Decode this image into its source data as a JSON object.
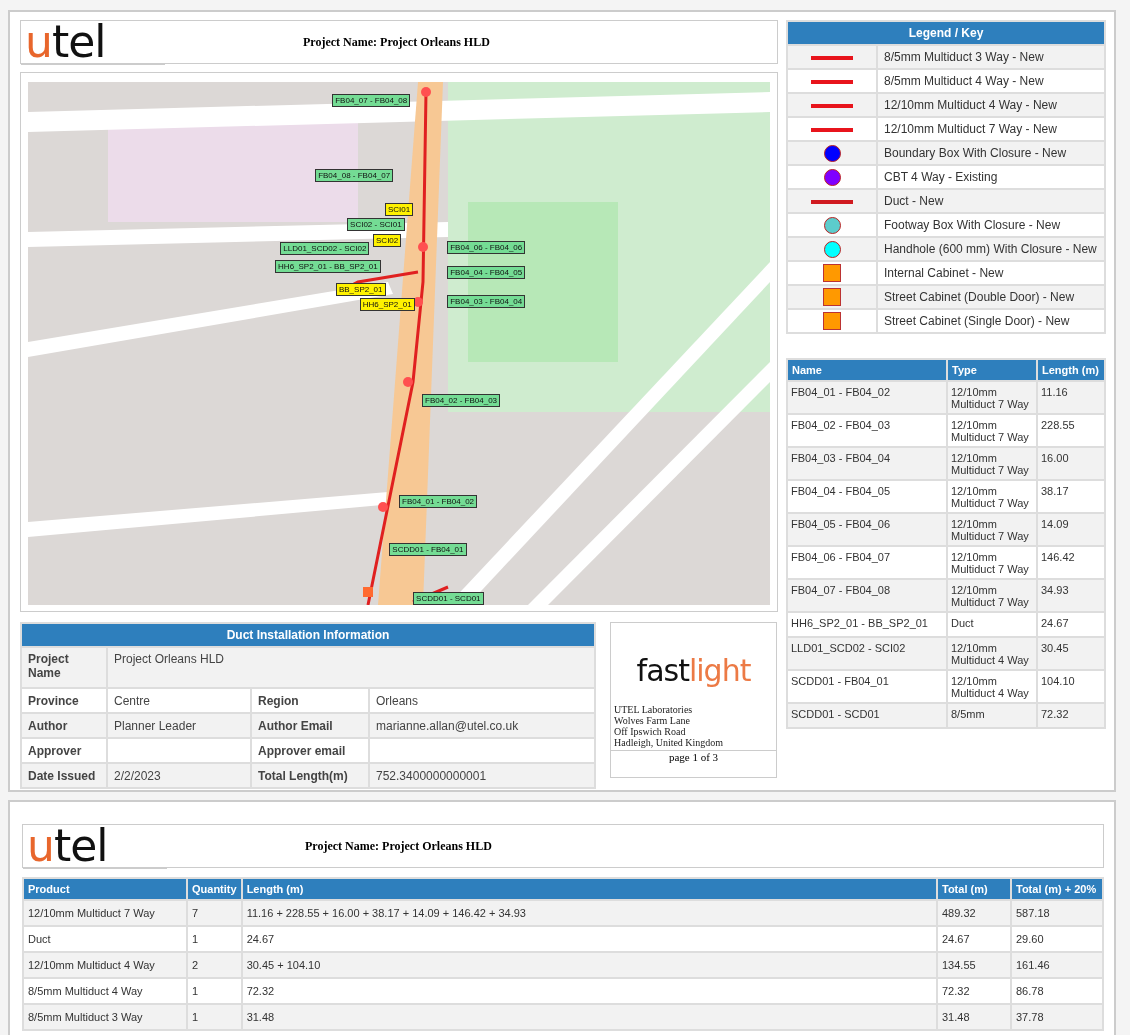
{
  "pages": [
    {
      "header": {
        "logo": {
          "accent": "u",
          "rest": "tel"
        },
        "title": "Project Name: Project Orleans HLD"
      },
      "map": {
        "kind": "picture",
        "labels": [
          {
            "text": "FB04_07 - FB04_08",
            "kind": "segment"
          },
          {
            "text": "FB04_08 - FB04_07",
            "kind": "segment"
          },
          {
            "text": "SCI01",
            "kind": "node"
          },
          {
            "text": "SCI02 - SCI01",
            "kind": "segment"
          },
          {
            "text": "SCI02",
            "kind": "node"
          },
          {
            "text": "LLD01_SCD02 - SCI02",
            "kind": "segment"
          },
          {
            "text": "FB04_06 - FB04_06",
            "kind": "segment"
          },
          {
            "text": "HH6_SP2_01 - BB_SP2_01",
            "kind": "segment"
          },
          {
            "text": "FB04_04 - FB04_05",
            "kind": "segment"
          },
          {
            "text": "BB_SP2_01",
            "kind": "node"
          },
          {
            "text": "HH6_SP2_01",
            "kind": "node"
          },
          {
            "text": "FB04_03 - FB04_04",
            "kind": "segment"
          },
          {
            "text": "FB04_02 - FB04_03",
            "kind": "segment"
          },
          {
            "text": "FB04_01 - FB04_02",
            "kind": "segment"
          },
          {
            "text": "SCDD01 - FB04_01",
            "kind": "segment"
          },
          {
            "text": "SCDD01 - SCD01",
            "kind": "segment"
          }
        ]
      },
      "info": {
        "title": "Duct Installation Information",
        "rows": [
          [
            {
              "label": "Project Name",
              "value": "Project Orleans HLD"
            }
          ],
          [
            {
              "label": "Province",
              "value": "Centre"
            },
            {
              "label": "Region",
              "value": "Orleans"
            }
          ],
          [
            {
              "label": "Author",
              "value": " Planner Leader"
            },
            {
              "label": "Author Email",
              "value": "marianne.allan@utel.co.uk"
            }
          ],
          [
            {
              "label": "Approver"
            },
            {
              "label": "Approver email"
            }
          ],
          [
            {
              "label": "Date Issued",
              "value": "2/2/2023"
            },
            {
              "label": "Total Length(m)",
              "value": "752.3400000000001"
            }
          ]
        ]
      },
      "company": {
        "logo": {
          "first": "fast",
          "second": "light"
        },
        "address": [
          "UTEL Laboratories",
          "Wolves Farm Lane",
          "Off Ipswich Road",
          "Hadleigh, United Kingdom"
        ],
        "page": "page 1 of 3"
      },
      "legend": {
        "title": "Legend / Key",
        "items": [
          {
            "kind": "line",
            "color": "#e8141c",
            "label": "8/5mm Multiduct 3 Way - New"
          },
          {
            "kind": "line",
            "color": "#e8141c",
            "label": "8/5mm Multiduct 4 Way - New"
          },
          {
            "kind": "line",
            "color": "#e8141c",
            "label": "12/10mm Multiduct 4 Way - New"
          },
          {
            "kind": "line",
            "color": "#e8141c",
            "label": "12/10mm Multiduct 7 Way - New"
          },
          {
            "kind": "circle",
            "color": "#0000ff",
            "label": "Boundary Box With Closure - New"
          },
          {
            "kind": "circle",
            "color": "#7f00ff",
            "label": "CBT 4 Way - Existing"
          },
          {
            "kind": "line",
            "color": "#d01a20",
            "label": "Duct - New"
          },
          {
            "kind": "circle",
            "color": "#5ccccc",
            "label": "Footway Box With Closure - New"
          },
          {
            "kind": "circle",
            "color": "#00ffff",
            "label": "Handhole (600 mm) With Closure - New"
          },
          {
            "kind": "square",
            "color": "#ff9900",
            "label": "Internal Cabinet - New"
          },
          {
            "kind": "square",
            "color": "#ff9900",
            "label": "Street Cabinet (Double Door) - New"
          },
          {
            "kind": "square",
            "color": "#ff9900",
            "label": "Street Cabinet (Single Door) - New"
          }
        ]
      },
      "segments": {
        "columns": [
          "Name",
          "Type",
          "Length (m)"
        ],
        "rows": [
          [
            "FB04_01 - FB04_02",
            "12/10mm Multiduct 7 Way",
            "11.16"
          ],
          [
            "FB04_02 - FB04_03",
            "12/10mm Multiduct 7 Way",
            "228.55"
          ],
          [
            "FB04_03 - FB04_04",
            "12/10mm Multiduct 7 Way",
            "16.00"
          ],
          [
            "FB04_04 - FB04_05",
            "12/10mm Multiduct 7 Way",
            "38.17"
          ],
          [
            "FB04_05 - FB04_06",
            "12/10mm Multiduct 7 Way",
            "14.09"
          ],
          [
            "FB04_06 - FB04_07",
            "12/10mm Multiduct 7 Way",
            "146.42"
          ],
          [
            "FB04_07 - FB04_08",
            "12/10mm Multiduct 7 Way",
            "34.93"
          ],
          [
            "HH6_SP2_01 - BB_SP2_01",
            "Duct",
            "24.67"
          ],
          [
            "LLD01_SCD02 - SCI02",
            "12/10mm Multiduct 4 Way",
            "30.45"
          ],
          [
            "SCDD01 - FB04_01",
            "12/10mm Multiduct 4 Way",
            "104.10"
          ],
          [
            "SCDD01 - SCD01",
            "8/5mm",
            "72.32"
          ]
        ]
      }
    },
    {
      "header": {
        "logo": {
          "accent": "u",
          "rest": "tel"
        },
        "title": "Project Name: Project Orleans HLD"
      },
      "products": {
        "columns": [
          "Product",
          "Quantity",
          "Length (m)",
          "Total (m)",
          "Total (m) + 20%"
        ],
        "rows": [
          [
            "12/10mm Multiduct 7 Way",
            "7",
            "11.16 + 228.55 + 16.00 + 38.17 + 14.09 + 146.42 + 34.93",
            "489.32",
            "587.18"
          ],
          [
            "Duct",
            "1",
            "24.67",
            "24.67",
            "29.60"
          ],
          [
            "12/10mm Multiduct 4 Way",
            "2",
            "30.45 + 104.10",
            "134.55",
            "161.46"
          ],
          [
            "8/5mm Multiduct 4 Way",
            "1",
            "72.32",
            "72.32",
            "86.78"
          ],
          [
            "8/5mm Multiduct 3 Way",
            "1",
            "31.48",
            "31.48",
            "37.78"
          ]
        ]
      }
    }
  ]
}
